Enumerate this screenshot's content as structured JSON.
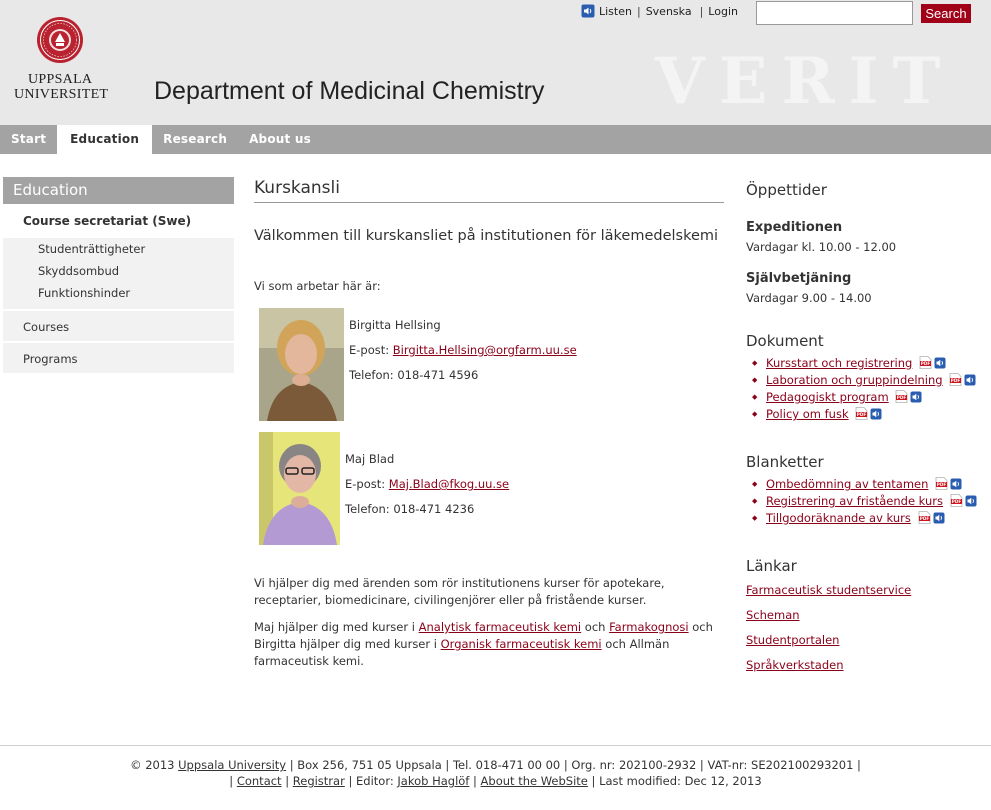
{
  "header": {
    "university_line1": "UPPSALA",
    "university_line2": "UNIVERSITET",
    "department": "Department of Medicinal Chemistry",
    "tools": {
      "listen": "Listen",
      "svenska": "Svenska",
      "login": "Login"
    },
    "search": {
      "placeholder": "",
      "value": "",
      "button": "Search"
    },
    "watermark": "VERIT"
  },
  "nav": {
    "tabs": [
      "Start",
      "Education",
      "Research",
      "About us"
    ],
    "active": "Education"
  },
  "sidebar": {
    "heading": "Education",
    "current": "Course secretariat (Swe)",
    "subitems": [
      "Studenträttigheter",
      "Skyddsombud",
      "Funktionshinder"
    ],
    "items": [
      "Courses",
      "Programs"
    ]
  },
  "main": {
    "title": "Kurskansli",
    "intro": "Välkommen till kurskansliet på institutionen för läkemedelskemi",
    "we_work": "Vi som arbetar här är:",
    "people": [
      {
        "name": "Birgitta Hellsing",
        "email_label": "E-post:",
        "email": "Birgitta.Hellsing@orgfarm.uu.se",
        "phone": "Telefon: 018-471 4596"
      },
      {
        "name": "Maj Blad",
        "email_label": "E-post:",
        "email": "Maj.Blad@fkog.uu.se",
        "phone": "Telefon: 018-471 4236"
      }
    ],
    "body1": "Vi hjälper dig med ärenden som rör institutionens kurser för apotekare, receptarier, biomedicinare, civilingenjörer eller på fristående kurser.",
    "body2": {
      "t1": "Maj hjälper dig med kurser i ",
      "l1": "Analytisk farmaceutisk kemi",
      "t2": " och ",
      "l2": "Farmakognosi",
      "t3": " och Birgitta hjälper dig med kurser i ",
      "l3": "Organisk farmaceutisk kemi",
      "t4": " och Allmän farmaceutisk kemi."
    }
  },
  "right": {
    "hours_title": "Öppettider",
    "exp_title": "Expeditionen",
    "exp_hours": "Vardagar kl. 10.00 - 12.00",
    "self_title": "Självbetjäning",
    "self_hours": "Vardagar 9.00 - 14.00",
    "docs_title": "Dokument",
    "docs": [
      "Kursstart och registrering",
      "Laboration och gruppindelning",
      "Pedagogiskt program",
      "Policy om fusk"
    ],
    "forms_title": "Blanketter",
    "forms": [
      "Ombedömning av tentamen",
      "Registrering av fristående kurs",
      "Tillgodoräknande av kurs"
    ],
    "links_title": "Länkar",
    "links": [
      "Farmaceutisk studentservice",
      "Scheman",
      "Studentportalen",
      "Språkverkstaden"
    ]
  },
  "footer": {
    "copy": "© 2013 ",
    "uu": "Uppsala University",
    "rest1": " | Box 256, 751 05 Uppsala | Tel. 018-471 00 00 | Org. nr: 202100-2932 | VAT-nr: SE202100293201 |",
    "contact": "Contact",
    "registrar": "Registrar",
    "editor_label": " | Editor: ",
    "editor": "Jakob Haglöf",
    "about": "About the WebSite",
    "modified": " | Last modified: Dec 12, 2013"
  },
  "colors": {
    "brand": "#a00018",
    "link": "#8b0019",
    "nav": "#a3a3a3"
  }
}
